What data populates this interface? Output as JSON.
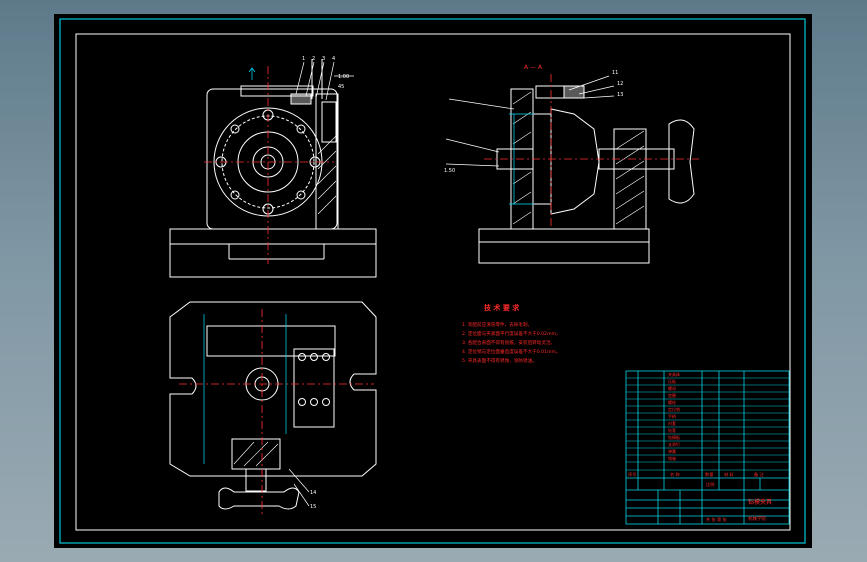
{
  "colors": {
    "background": "#000000",
    "frame": "#00c8dc",
    "border": "#ffffff",
    "geometry": "#ffffff",
    "centerline": "#ff3030",
    "dimension": "#00e0ff",
    "hatch": "#ffffff",
    "notes": "#ff2a2a",
    "title_block": "#00d8e8",
    "title_text": "#ff2a2a"
  },
  "views": {
    "section_label": "A — A",
    "front_callouts": [
      "1",
      "2",
      "3",
      "4"
    ],
    "side_callouts": [
      "11",
      "12",
      "13"
    ],
    "plan_callouts": [
      "14",
      "15"
    ],
    "front_dim_1": "1.00",
    "front_dim_2": "45",
    "side_dim": "1.50"
  },
  "notes": {
    "title": "技 术 要 求",
    "lines": [
      "1. 装配前应清洗零件，去除毛刺。",
      "2. 定位面与夹紧面平行度误差不大于0.02mm。",
      "3. 各配合表面不得有划痕，安装后转动灵活。",
      "4. 定位销与定位面垂直度误差不大于0.01mm。",
      "5. 夹具表面不得有锈蚀，涂防锈油。"
    ]
  },
  "title_block": {
    "table_rows": [
      "夹具体",
      "压板",
      "螺母",
      "垫圈",
      "螺栓",
      "定位销",
      "手柄",
      "衬套",
      "钻套",
      "钻模板",
      "支承钉",
      "弹簧",
      "销轴",
      "序号"
    ],
    "header_cells": [
      "序号",
      "名 称",
      "数量",
      "材 料",
      "备 注"
    ],
    "drawing_title": "钻模夹具",
    "school": "机械学院",
    "scale_label": "比例",
    "sheet_label": "共 张 第 张"
  }
}
